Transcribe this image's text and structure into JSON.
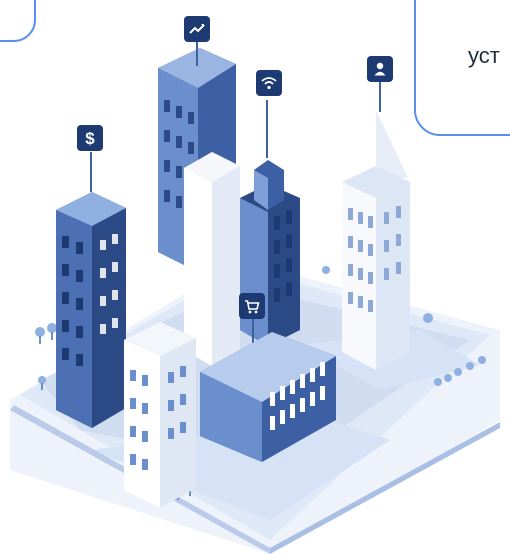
{
  "callout": {
    "text": "уст"
  },
  "badges": {
    "finance_symbol": "$"
  },
  "colors": {
    "frame_border": "#5b8def",
    "badge_fill": "#1e3a72",
    "building_dark": "#3d5fa3",
    "building_mid": "#6b8fcc",
    "building_light": "#f5f7fb",
    "ground": "#dfe8f6"
  },
  "icons": [
    "chart-icon",
    "wifi-icon",
    "user-icon",
    "dollar-icon",
    "cart-icon"
  ]
}
